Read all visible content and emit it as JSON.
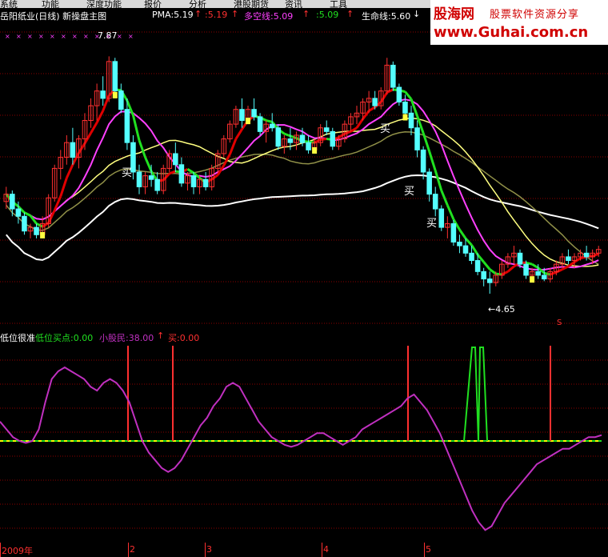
{
  "menu": [
    "系统",
    "功能",
    "深度功能",
    "报价",
    "分析",
    "港股期货",
    "资讯",
    "工具"
  ],
  "main_header": {
    "title": "岳阳纸业(日线) 新操盘主图",
    "pma": "PMA:5.19",
    "v2": ":5.19",
    "dkx_label": "多空线:5.09",
    "v4": ":5.09",
    "life": "生命线:5.60"
  },
  "indicator_header": {
    "name": "低位很准",
    "low_point": "低位买点:0.00",
    "small_holders": "小股民:38.00",
    "buy": "买:0.00"
  },
  "logo": {
    "line1": "股海网",
    "line2": "股票软件资源分享",
    "line3": "www.Guhai.com.cn"
  },
  "annotations": {
    "high": "7.87",
    "low": "←4.65",
    "buy_marks": [
      "买",
      "买",
      "买",
      "买"
    ],
    "s_marker": "S"
  },
  "x_axis": [
    "2009年",
    "2",
    "3",
    "4",
    "5"
  ],
  "colors": {
    "up": "#ff3030",
    "down": "#54ffff",
    "flag": "#ffff40",
    "ma_red": "#e00000",
    "ma_green": "#20e020",
    "ma_pink": "#ff40ff",
    "ma_yellow": "#ffff80",
    "ma_white": "#ffffff",
    "ma_olive": "#909048",
    "grid": "#8b0000",
    "dash": "#ffff00",
    "osc": "#c030c0"
  },
  "chart_data": [
    {
      "type": "candlestick",
      "title": "岳阳纸业(日线) 新操盘主图",
      "ylim": [
        4.4,
        8.2
      ],
      "annotated_high": 7.87,
      "annotated_low": 4.65,
      "ohlc": [
        [
          5.9,
          6.1,
          5.8,
          6.0
        ],
        [
          6.0,
          6.05,
          5.7,
          5.8
        ],
        [
          5.8,
          5.9,
          5.6,
          5.7
        ],
        [
          5.7,
          5.75,
          5.45,
          5.5
        ],
        [
          5.5,
          5.6,
          5.4,
          5.55
        ],
        [
          5.55,
          5.6,
          5.4,
          5.45
        ],
        [
          5.45,
          5.7,
          5.4,
          5.6
        ],
        [
          5.6,
          6.0,
          5.55,
          5.95
        ],
        [
          5.95,
          6.4,
          5.9,
          6.35
        ],
        [
          6.35,
          6.6,
          6.2,
          6.5
        ],
        [
          6.5,
          6.8,
          6.4,
          6.7
        ],
        [
          6.7,
          6.9,
          6.4,
          6.5
        ],
        [
          6.5,
          6.8,
          6.35,
          6.75
        ],
        [
          6.75,
          7.1,
          6.6,
          7.0
        ],
        [
          7.0,
          7.3,
          6.9,
          7.2
        ],
        [
          7.2,
          7.5,
          7.0,
          7.4
        ],
        [
          7.4,
          7.6,
          7.2,
          7.3
        ],
        [
          7.3,
          7.87,
          7.25,
          7.8
        ],
        [
          7.8,
          7.85,
          7.3,
          7.4
        ],
        [
          7.4,
          7.5,
          7.1,
          7.15
        ],
        [
          7.15,
          7.3,
          6.6,
          6.7
        ],
        [
          6.7,
          6.8,
          6.2,
          6.3
        ],
        [
          6.3,
          6.4,
          6.0,
          6.1
        ],
        [
          6.1,
          6.3,
          6.0,
          6.25
        ],
        [
          6.25,
          6.4,
          6.1,
          6.2
        ],
        [
          6.2,
          6.3,
          6.0,
          6.05
        ],
        [
          6.05,
          6.4,
          6.0,
          6.35
        ],
        [
          6.35,
          6.6,
          6.3,
          6.55
        ],
        [
          6.55,
          6.7,
          6.3,
          6.4
        ],
        [
          6.4,
          6.5,
          6.1,
          6.15
        ],
        [
          6.15,
          6.3,
          6.05,
          6.25
        ],
        [
          6.25,
          6.3,
          6.0,
          6.1
        ],
        [
          6.1,
          6.25,
          6.0,
          6.2
        ],
        [
          6.2,
          6.3,
          6.05,
          6.1
        ],
        [
          6.1,
          6.4,
          6.05,
          6.35
        ],
        [
          6.35,
          6.6,
          6.3,
          6.55
        ],
        [
          6.55,
          6.8,
          6.5,
          6.75
        ],
        [
          6.75,
          7.0,
          6.7,
          6.95
        ],
        [
          6.95,
          7.2,
          6.9,
          7.15
        ],
        [
          7.15,
          7.3,
          6.9,
          7.0
        ],
        [
          7.0,
          7.2,
          6.95,
          7.15
        ],
        [
          7.15,
          7.3,
          7.0,
          7.05
        ],
        [
          7.05,
          7.1,
          6.8,
          6.85
        ],
        [
          6.85,
          7.0,
          6.7,
          6.95
        ],
        [
          6.95,
          7.1,
          6.85,
          6.9
        ],
        [
          6.9,
          6.95,
          6.6,
          6.65
        ],
        [
          6.65,
          6.8,
          6.55,
          6.75
        ],
        [
          6.75,
          6.9,
          6.6,
          6.7
        ],
        [
          6.7,
          6.85,
          6.6,
          6.8
        ],
        [
          6.8,
          6.9,
          6.65,
          6.7
        ],
        [
          6.7,
          6.8,
          6.55,
          6.6
        ],
        [
          6.6,
          6.75,
          6.55,
          6.7
        ],
        [
          6.7,
          6.95,
          6.65,
          6.9
        ],
        [
          6.9,
          7.0,
          6.8,
          6.85
        ],
        [
          6.85,
          6.9,
          6.6,
          6.65
        ],
        [
          6.65,
          6.8,
          6.6,
          6.75
        ],
        [
          6.75,
          7.0,
          6.7,
          6.95
        ],
        [
          6.95,
          7.1,
          6.85,
          7.05
        ],
        [
          7.05,
          7.2,
          6.95,
          7.1
        ],
        [
          7.1,
          7.3,
          7.0,
          7.25
        ],
        [
          7.25,
          7.4,
          7.1,
          7.3
        ],
        [
          7.3,
          7.4,
          7.15,
          7.2
        ],
        [
          7.2,
          7.45,
          7.15,
          7.4
        ],
        [
          7.4,
          7.85,
          7.35,
          7.75
        ],
        [
          7.75,
          7.8,
          7.4,
          7.45
        ],
        [
          7.45,
          7.5,
          7.2,
          7.25
        ],
        [
          7.25,
          7.35,
          7.0,
          7.1
        ],
        [
          7.1,
          7.2,
          6.8,
          6.9
        ],
        [
          6.9,
          7.0,
          6.5,
          6.6
        ],
        [
          6.6,
          6.65,
          6.2,
          6.3
        ],
        [
          6.3,
          6.35,
          5.9,
          6.0
        ],
        [
          6.0,
          6.1,
          5.7,
          5.8
        ],
        [
          5.8,
          5.85,
          5.5,
          5.55
        ],
        [
          5.55,
          5.7,
          5.4,
          5.6
        ],
        [
          5.6,
          5.65,
          5.3,
          5.35
        ],
        [
          5.35,
          5.45,
          5.2,
          5.3
        ],
        [
          5.3,
          5.4,
          5.15,
          5.2
        ],
        [
          5.2,
          5.3,
          5.05,
          5.1
        ],
        [
          5.1,
          5.2,
          4.9,
          4.95
        ],
        [
          4.95,
          5.0,
          4.75,
          4.85
        ],
        [
          4.85,
          4.95,
          4.65,
          4.8
        ],
        [
          4.8,
          4.95,
          4.75,
          4.9
        ],
        [
          4.9,
          5.1,
          4.85,
          5.05
        ],
        [
          5.05,
          5.2,
          5.0,
          5.15
        ],
        [
          5.15,
          5.3,
          5.05,
          5.2
        ],
        [
          5.2,
          5.25,
          5.0,
          5.05
        ],
        [
          5.05,
          5.1,
          4.85,
          4.9
        ],
        [
          4.9,
          5.0,
          4.8,
          4.95
        ],
        [
          4.95,
          5.05,
          4.85,
          4.9
        ],
        [
          4.9,
          5.0,
          4.82,
          4.85
        ],
        [
          4.85,
          5.0,
          4.8,
          4.95
        ],
        [
          4.95,
          5.1,
          4.9,
          5.05
        ],
        [
          5.05,
          5.2,
          5.0,
          5.15
        ],
        [
          5.15,
          5.25,
          5.05,
          5.1
        ],
        [
          5.1,
          5.2,
          5.0,
          5.15
        ],
        [
          5.15,
          5.25,
          5.1,
          5.2
        ],
        [
          5.2,
          5.3,
          5.1,
          5.15
        ],
        [
          5.15,
          5.25,
          5.05,
          5.2
        ],
        [
          5.2,
          5.3,
          5.15,
          5.25
        ]
      ]
    },
    {
      "type": "line",
      "title": "低位很准",
      "series": [
        {
          "name": "小股民",
          "values": [
            60,
            56,
            52,
            50,
            49,
            50,
            56,
            70,
            82,
            86,
            88,
            86,
            84,
            82,
            78,
            76,
            80,
            82,
            80,
            76,
            70,
            60,
            50,
            44,
            40,
            36,
            34,
            36,
            40,
            46,
            52,
            58,
            62,
            68,
            72,
            78,
            80,
            78,
            72,
            66,
            60,
            56,
            52,
            50,
            48,
            47,
            48,
            50,
            52,
            54,
            54,
            52,
            50,
            48,
            50,
            52,
            56,
            58,
            60,
            62,
            64,
            66,
            68,
            72,
            74,
            70,
            66,
            60,
            54,
            46,
            38,
            30,
            22,
            14,
            8,
            4,
            6,
            12,
            18,
            22,
            26,
            30,
            34,
            38,
            40,
            42,
            44,
            46,
            46,
            48,
            50,
            52,
            52,
            53
          ]
        }
      ],
      "ylim": [
        0,
        100
      ],
      "baseline": 50
    }
  ]
}
